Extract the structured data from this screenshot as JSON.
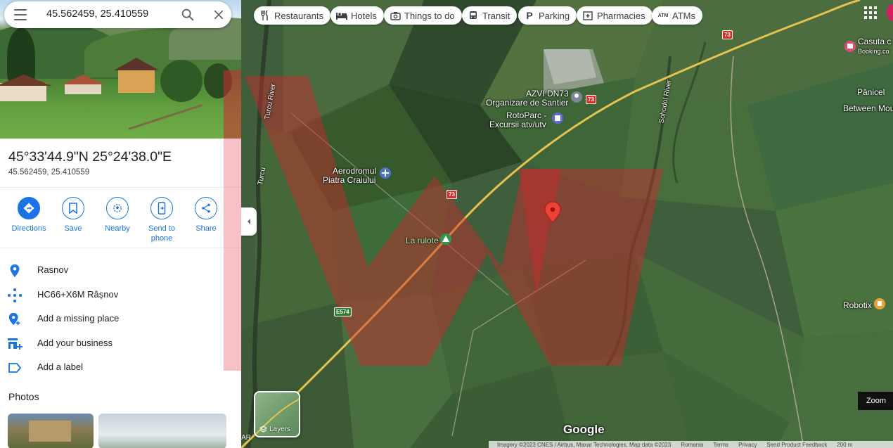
{
  "search": {
    "query": "45.562459, 25.410559"
  },
  "place": {
    "title": "45°33'44.9\"N 25°24'38.0\"E",
    "subtitle": "45.562459, 25.410559"
  },
  "actions": [
    {
      "label": "Directions",
      "icon": "directions-icon"
    },
    {
      "label": "Save",
      "icon": "bookmark-icon"
    },
    {
      "label": "Nearby",
      "icon": "nearby-icon"
    },
    {
      "label": "Send to phone",
      "icon": "send-to-phone-icon"
    },
    {
      "label": "Share",
      "icon": "share-icon"
    }
  ],
  "info_rows": [
    {
      "text": "Rasnov",
      "icon": "location-pin-icon"
    },
    {
      "text": "HC66+X6M Râșnov",
      "icon": "plus-code-icon"
    },
    {
      "text": "Add a missing place",
      "icon": "add-place-icon"
    },
    {
      "text": "Add your business",
      "icon": "add-business-icon"
    },
    {
      "text": "Add a label",
      "icon": "label-icon"
    }
  ],
  "photos": {
    "title": "Photos"
  },
  "chips": [
    {
      "label": "Restaurants",
      "icon": "fork-knife-icon"
    },
    {
      "label": "Hotels",
      "icon": "bed-icon"
    },
    {
      "label": "Things to do",
      "icon": "camera-icon"
    },
    {
      "label": "Transit",
      "icon": "bus-icon"
    },
    {
      "label": "Parking",
      "icon": "parking-icon"
    },
    {
      "label": "Pharmacies",
      "icon": "pharmacy-icon"
    },
    {
      "label": "ATMs",
      "icon": "atm-icon"
    }
  ],
  "map_labels": {
    "azvi": "AZVI DN73",
    "organizare": "Organizare de Santier",
    "rotoparc": "RotoParc -",
    "excursii": "Excursii atv/utv",
    "aerodrom1": "Aerodromul",
    "aerodrom2": "Piatra Craiului",
    "larulote": "La rulote",
    "robotix": "Robotix",
    "casuta": "Casuta c",
    "booking": "Booking.co",
    "panicel": "Pânicel",
    "between": "Between Mount",
    "turcu1": "Turcu River",
    "turcu2": "Turcu",
    "sohodol": "Sohodol River",
    "road73a": "73",
    "road73b": "73",
    "road73c": "73",
    "e574": "E574",
    "edge": "AR"
  },
  "controls": {
    "layers": "Layers",
    "zoom": "Zoom",
    "google": "Google"
  },
  "attribution": [
    "Imagery ©2023 CNES / Airbus, Maxar Technologies, Map data ©2023",
    "Romania",
    "Terms",
    "Privacy",
    "Send Product Feedback",
    "200 m"
  ],
  "colors": {
    "accent": "#1a73e8",
    "pin": "#ea4335",
    "watermark": "#d0282c"
  }
}
